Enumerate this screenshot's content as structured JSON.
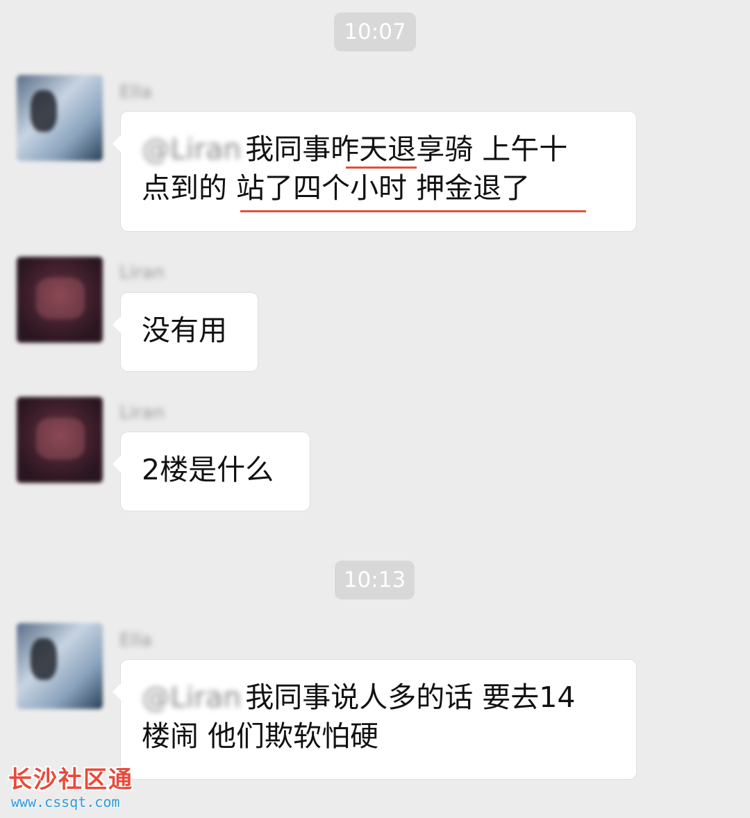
{
  "chat": {
    "timestamps": [
      "10:07",
      "10:13"
    ],
    "messages": [
      {
        "sender": "Ella",
        "mention": "@Liran",
        "lines": [
          "我同事昨天退享骑 上午十",
          "点到的 站了四个小时 押金退了"
        ]
      },
      {
        "sender": "Liran",
        "text": "没有用"
      },
      {
        "sender": "Liran",
        "text": "2楼是什么"
      },
      {
        "sender": "Ella",
        "mention": "@Liran",
        "lines": [
          "我同事说人多的话 要去14",
          "楼闹 他们欺软怕硬"
        ]
      }
    ]
  },
  "watermark": {
    "title": "长沙社区通",
    "url": "www.cssqt.com"
  },
  "colors": {
    "background": "#ececec",
    "underline": "#e0503a",
    "watermark_title": "#e84a3a",
    "watermark_url": "#2a9ad9"
  }
}
